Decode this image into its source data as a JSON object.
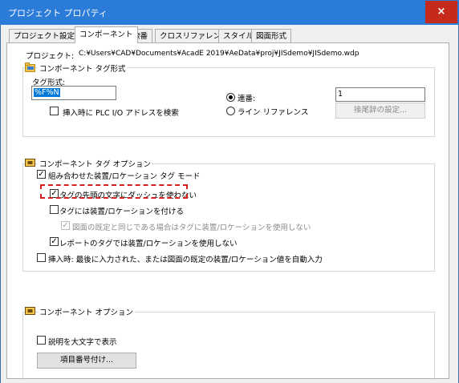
{
  "window": {
    "title": "プロジェクト プロパティ",
    "close_glyph": "×"
  },
  "tabs": [
    {
      "label": "プロジェクト設定",
      "active": false
    },
    {
      "label": "コンポーネント",
      "active": true
    },
    {
      "label": "線番",
      "active": false
    },
    {
      "label": "クロスリファレンス",
      "active": false
    },
    {
      "label": "スタイル",
      "active": false
    },
    {
      "label": "図面形式",
      "active": false
    }
  ],
  "project": {
    "label": "プロジェクト:",
    "path": "C:¥Users¥CAD¥Documents¥AcadE 2019¥AeData¥proj¥JISdemo¥JISdemo.wdp"
  },
  "tag_format": {
    "title": "コンポーネント タグ形式",
    "field_label": "タグ形式:",
    "value": "%F%N",
    "search_plc_label": "挿入時に PLC I/O アドレスを検索",
    "search_plc_checked": false,
    "sequential_label": "連番:",
    "sequential_selected": true,
    "sequential_value": "1",
    "line_ref_label": "ライン リファレンス",
    "line_ref_selected": false,
    "suffix_button": "接尾辞の設定..."
  },
  "tag_options": {
    "title": "コンポーネント タグ オプション",
    "combined_label": "組み合わせた装置/ロケーション タグ モード",
    "combined_checked": true,
    "no_dash_label": "タグの先頭の文字にダッシュを使わない",
    "no_dash_checked": true,
    "add_loc_label": "タグには装置/ロケーションを付ける",
    "add_loc_checked": false,
    "same_default_label": "図面の既定と同じである場合はタグに装置/ロケーションを使用しない",
    "same_default_checked": true,
    "report_label": "レポートのタグでは装置/ロケーションを使用しない",
    "report_checked": true,
    "insert_label": "挿入時: 最後に入力された、または図面の既定の装置/ロケーション値を自動入力",
    "insert_checked": false
  },
  "comp_options": {
    "title": "コンポーネント オプション",
    "uppercase_label": "説明を大文字で表示",
    "uppercase_checked": false,
    "item_number_button": "項目番号付け..."
  },
  "glyphs": {
    "check": "✓"
  },
  "colors": {
    "title_bar": "#2b7bd9",
    "close_button": "#c42b1c",
    "highlight": "#d42020",
    "selection": "#0078d7"
  },
  "icons": {
    "tag_format_icon": "folder-tag-icon",
    "group_icon": "component-group-icon"
  }
}
